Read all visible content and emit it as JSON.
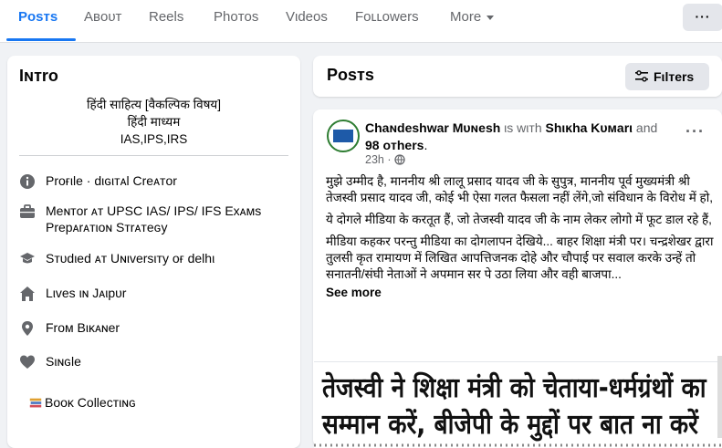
{
  "nav": {
    "tabs": [
      "Poѕтѕ",
      "Aвoᴜт",
      "Reelѕ",
      "Phoтoѕ",
      "Vιdeoѕ",
      "Foʟʟowerѕ",
      "More"
    ],
    "more_menu_label": "···"
  },
  "intro": {
    "title": "Iɴтro",
    "bio": [
      "हिंदी साहित्य [वैकल्पिक विषय]",
      "हिंदी माध्यम",
      "IAS,IPS,IRS"
    ],
    "items": [
      {
        "icon": "info-icon",
        "text": "Proғιle · dιɢιтᴀl Creᴀтor"
      },
      {
        "icon": "briefcase-icon",
        "text": "Meɴтor ᴀт UPSC IAS/ IPS/ IFS Exᴀмѕ Prepᴀrᴀтιoɴ Sтrᴀтeɢy"
      },
      {
        "icon": "graduation-cap-icon",
        "text": "Sтᴜdιed ᴀт Uɴιverѕιтy oғ delhι"
      },
      {
        "icon": "home-icon",
        "text": "Lιveѕ ιɴ Jᴀιpᴜr"
      },
      {
        "icon": "location-pin-icon",
        "text": "Froм Bιĸᴀɴer"
      },
      {
        "icon": "heart-icon",
        "text": "Sιɴɢle"
      },
      {
        "icon": "books-icon",
        "text": "Booĸ Colleᴄтιɴɢ"
      }
    ]
  },
  "posts_header": {
    "title": "Poѕтѕ",
    "filters_label": "Fιlтerѕ"
  },
  "post": {
    "author": "Chaɴdeѕhwar Mᴜɴeѕh",
    "connector": " ιѕ wιтh ",
    "tagged": "Shιĸha Kᴜмarι",
    "and": " and ",
    "others": "98 oтherѕ",
    "time": "23h ·",
    "paragraphs": [
      "मुझे उम्मीद है, माननीय श्री लालू प्रसाद यादव जी के सुपुत्र, माननीय पूर्व मुख्यमंत्री श्री तेजस्वी प्रसाद यादव जी, कोई भी ऐसा गलत फैसला नहीं लेंगे,जो संविधान के विरोध में हो,",
      "ये दोगले मीडिया के करतूत हैं, जो तेजस्वी यादव जी के नाम लेकर लोगो में फूट डाल रहे हैं,",
      "मीडिया कहकर परन्तु मीडिया का दोगलापन देखिये... बाहर शिक्षा मंत्री पर। चन्द्रशेखर द्वारा तुलसी कृत रामायण में लिखित आपत्तिजनक दोहे और चौपाई पर सवाल करके उन्हें तो सनातनी/संघी नेताओं ने अपमान सर पे उठा लिया और वही बाजपा..."
    ],
    "see_more": "See more",
    "image_lines": [
      "तेजस्वी ने शिक्षा मंत्री को चेताया-धर्मग्रंथों का",
      "सम्मान करें, बीजेपी के मुद्दों पर बात ना करें"
    ]
  },
  "colors": {
    "accent": "#1877f2",
    "text": "#050505",
    "muted": "#65676b"
  }
}
